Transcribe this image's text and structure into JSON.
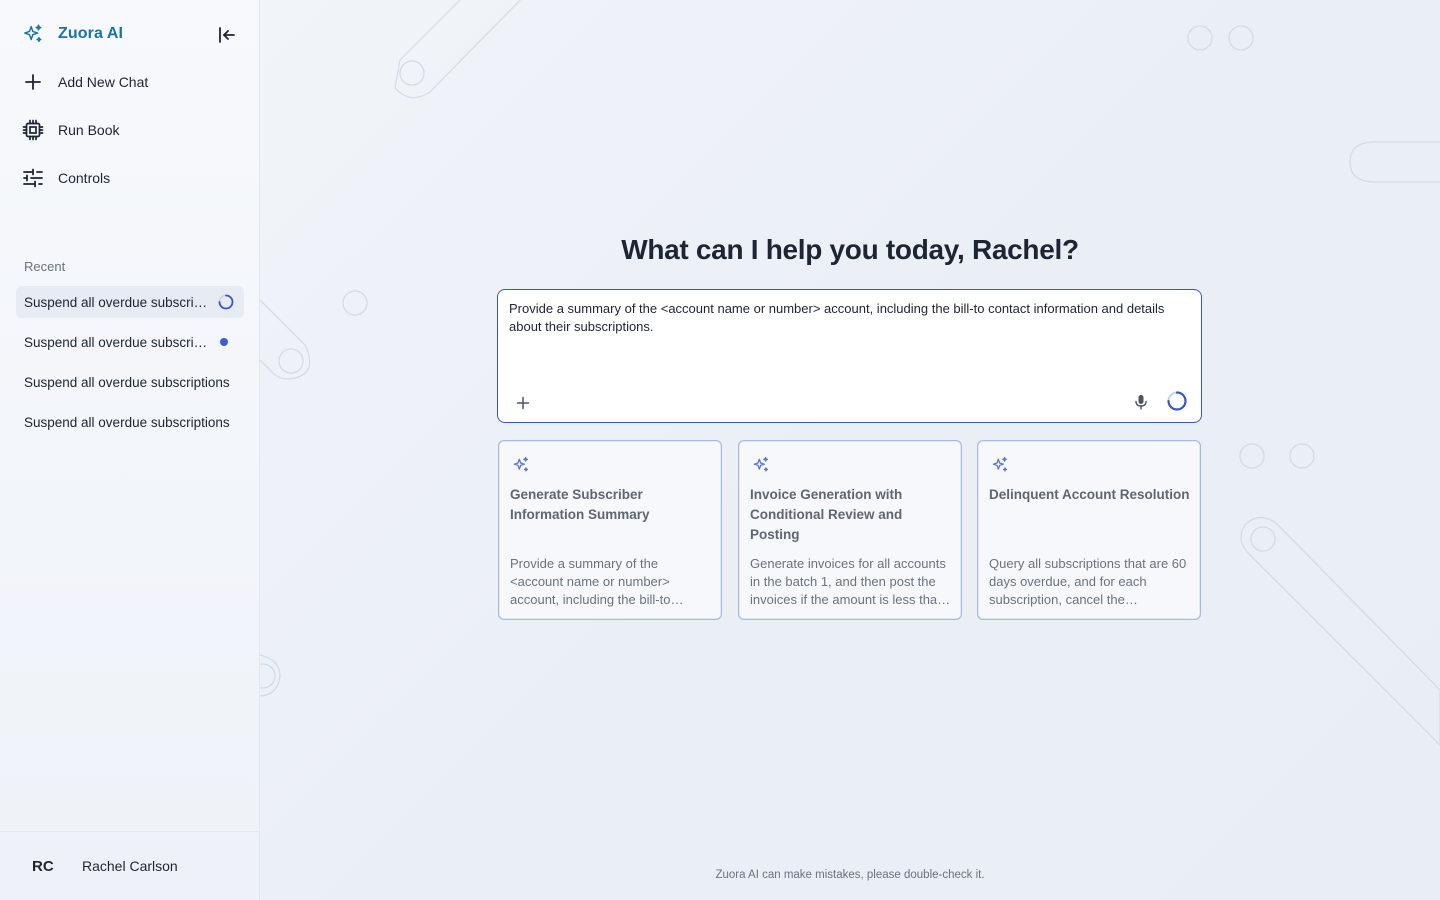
{
  "brand": {
    "name": "Zuora AI",
    "accent": "#1a73a8"
  },
  "sidebar": {
    "collapse_icon": "collapse-left-icon",
    "nav": [
      {
        "label": "Add New Chat",
        "icon": "plus-icon"
      },
      {
        "label": "Run Book",
        "icon": "chip-icon"
      },
      {
        "label": "Controls",
        "icon": "sliders-icon"
      }
    ],
    "recent_title": "Recent",
    "recent": [
      {
        "label": "Suspend all overdue subscriptions",
        "status": "loading"
      },
      {
        "label": "Suspend all overdue subscriptions",
        "status": "unread"
      },
      {
        "label": "Suspend all overdue subscriptions",
        "status": ""
      },
      {
        "label": "Suspend all overdue subscriptions",
        "status": ""
      }
    ],
    "user": {
      "initials": "RC",
      "name": "Rachel Carlson"
    }
  },
  "main": {
    "headline": "What can I help you today, Rachel?",
    "prompt": {
      "value": "Provide a summary of the <account name or number> account, including the bill-to contact information and details about their subscriptions."
    },
    "cards": [
      {
        "title": "Generate Subscriber Information Summary",
        "description": "Provide a summary of the <account name or number> account, including the bill-to contact information and details about their subscriptions."
      },
      {
        "title": "Invoice Generation with Conditional Review and Posting",
        "description": "Generate invoices for all accounts in the batch 1, and then post the invoices if the amount is less than the threshold."
      },
      {
        "title": "Delinquent Account Resolution",
        "description": "Query all subscriptions that are 60 days overdue, and for each subscription, cancel the subscription."
      }
    ],
    "disclaimer": "Zuora AI can make mistakes, please double-check it."
  },
  "colors": {
    "primary": "#3b56c4",
    "unread_dot": "#3b5bdb",
    "card_border": "#a7b8e6"
  }
}
